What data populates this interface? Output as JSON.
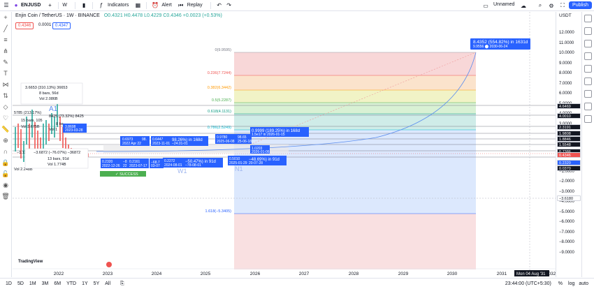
{
  "toolbar": {
    "symbol": "ENJUSD",
    "interval": "W",
    "indicators": "Indicators",
    "alert": "Alert",
    "replay": "Replay",
    "layout_name": "Unnamed",
    "publish": "Publish"
  },
  "legend": {
    "title": "Enjin Coin / TetherUS · 1W · BINANCE",
    "open": "O0.4321",
    "high": "H0.4478",
    "low": "L0.4229",
    "close": "C0.4346",
    "change": "+0.0023 (+0.53%)",
    "bid": "0.4346",
    "spread": "0.0001",
    "ask": "0.4347"
  },
  "currency": "USDT",
  "price_axis": [
    "12.0000",
    "11.0000",
    "10.0000",
    "9.0000",
    "8.0000",
    "7.0000",
    "6.0000",
    "5.0000",
    "4.0000",
    "3.0000",
    "2.0000",
    "1.0000",
    "−1.0000",
    "−2.0000",
    "−3.0000",
    "−4.0000",
    "−5.0000",
    "−6.0000",
    "−7.0000",
    "−8.0000",
    "−9.0000"
  ],
  "price_tags": [
    "4.6469",
    "4.0010",
    "2.3191",
    "1.9808",
    "1.8846",
    "1.5548",
    "0.7386",
    "0.4346",
    "0.2320",
    "0.0370",
    "−3.6180"
  ],
  "time_axis": [
    "2022",
    "2023",
    "2024",
    "2025",
    "2026",
    "2027",
    "2028",
    "2029",
    "2030",
    "2031",
    "2032"
  ],
  "crosshair_time": "Mon 04 Aug '31",
  "fib_levels": [
    "0(9.9595)",
    "0.236(7.7244)",
    "0.382(6.3442)",
    "0.5(5.2287)",
    "0.618(4.1131)",
    "0.786(2.5249)",
    "1.618(−5.3405)"
  ],
  "annotations": {
    "big_projection_line1": "8.4352 (554.82%) in 1631d",
    "big_projection_line2": "9.9556 ⬤ 2030-06-24",
    "measure1_line1": "3.6653 (310.13%) 36653",
    "measure1_line2": "8 bars, 56d",
    "measure1_line3": "Vol 2.086B",
    "measure2_line1": "−3.6872 (−76.07%) −36872",
    "measure2_line2": "13 bars, 91d",
    "measure2_line3": "Vol 1.774B",
    "left_label1": "5785 (213.17%)",
    "left_label2": "15 bars, 105",
    "left_label3": "Vol 3.675B",
    "left_label4": "−1.138",
    "left_label5": "Vol 2.248B",
    "partial1": "8425 (73.32%) 8425",
    "partial2": "8 ba",
    "partial3": "Vol 1",
    "a1": "A1",
    "w1": "W1",
    "n1": "N1",
    "success": "✓ SUCCESS",
    "box_a": "3.8608",
    "box_a2": "2023-03-28",
    "box_b": "0.6973",
    "box_b2": "2022 Apr 22",
    "box_c": "0.6447",
    "box_c2": "2023-11-01",
    "box_d": "98.26%) in 168d",
    "box_d2": "−24.01-01",
    "box_e": "0.9780",
    "box_e2": "2025-06-08",
    "box_f": "98.65",
    "box_f2": "25-06-18",
    "box_g": "0.9999 (189.25%) in 168d",
    "box_g2": "1.5e17 in 2026-01-15",
    "box_h": "1.0203",
    "box_h2": "2026-01-06",
    "low_a": "0.2320",
    "low_a2": "2022-12-26",
    "low_b": "0.2161",
    "low_b2": "2023-07-17",
    "low_c": "−68.7",
    "low_c2": "03-07",
    "low_d": "0.2272",
    "low_d2": "2024-08-01",
    "low_e": "−50.47%) in 91d",
    "low_e2": "−78-08-01",
    "low_f": "0.5010",
    "low_f2": "2025-01-29",
    "low_g": "−48.69%) in 91d",
    "low_g2": "20-07-28",
    "low_x1": "−8",
    "low_x2": "22"
  },
  "bottom": {
    "ranges": [
      "1D",
      "5D",
      "1M",
      "3M",
      "6M",
      "YTD",
      "1Y",
      "5Y",
      "All"
    ],
    "clock": "23:44:00 (UTC+5:30)",
    "percent": "%",
    "log": "log",
    "auto": "auto"
  },
  "watermark": "TradingView",
  "colors": {
    "accent": "#2962ff",
    "up": "#26a69a",
    "down": "#ef5350",
    "fib_blue": "#cfe0fb",
    "fib_red": "#f8d7d8"
  }
}
